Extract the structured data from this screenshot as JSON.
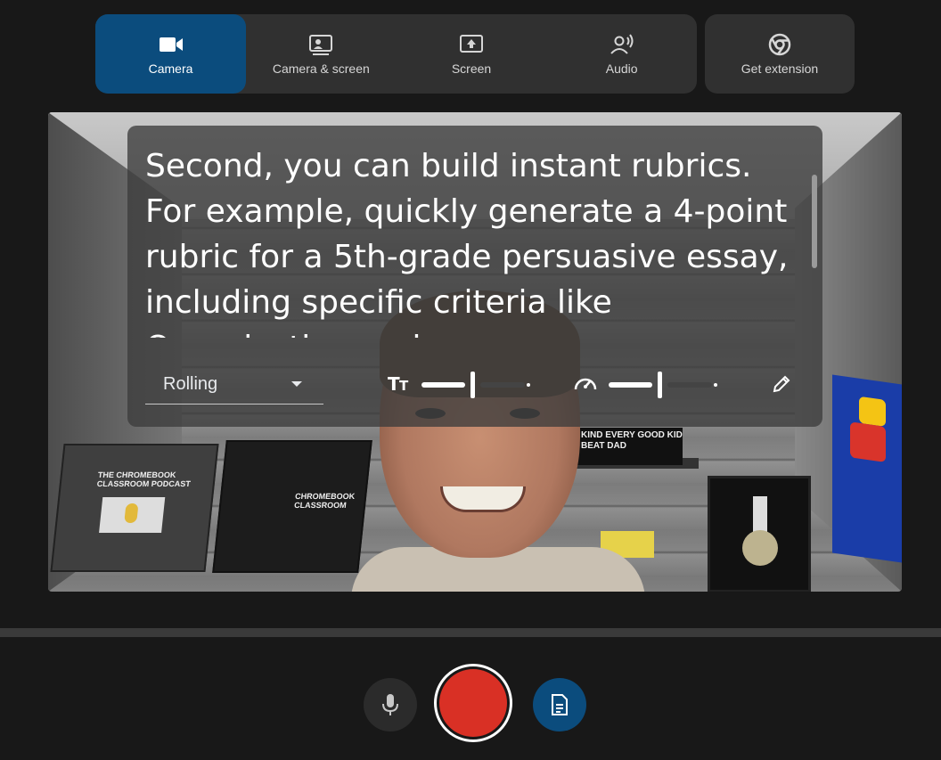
{
  "modes": {
    "camera": {
      "label": "Camera",
      "icon": "videocam-icon"
    },
    "camera_screen": {
      "label": "Camera & screen",
      "icon": "camera-screen-icon"
    },
    "screen": {
      "label": "Screen",
      "icon": "present-screen-icon"
    },
    "audio": {
      "label": "Audio",
      "icon": "record-voice-icon"
    },
    "active": "Camera"
  },
  "extension": {
    "label": "Get extension",
    "icon": "chrome-icon"
  },
  "caption": {
    "text": "Second, you can build instant rubrics. For example, quickly generate a 4-point rubric for a 5th-grade persuasive essay, including specific criteria like Organization and"
  },
  "controls": {
    "scroll_mode": "Rolling",
    "text_size_icon": "text-size-icon",
    "text_size_level": 0.45,
    "speed_icon": "speed-icon",
    "speed_level": 0.45,
    "edit_icon": "pencil-icon"
  },
  "background_scene": {
    "poster1_label": "THE CHROMEBOOK CLASSROOM PODCAST",
    "poster2_label": "CHROMEBOOK CLASSROOM",
    "sign_label": "KIND EVERY GOOD KID BEAT DAD"
  },
  "bottom": {
    "mic_icon": "microphone-icon",
    "record_icon": "record-icon",
    "transcript_icon": "document-icon"
  },
  "colors": {
    "accent": "#0b4c7d",
    "record": "#d93025",
    "panel": "#303030",
    "background": "#181818"
  }
}
